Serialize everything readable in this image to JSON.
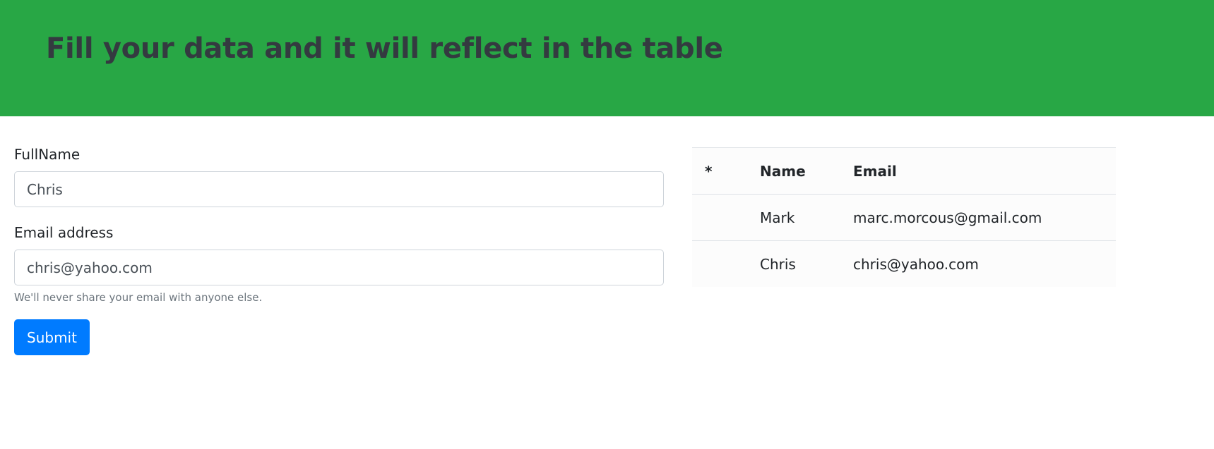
{
  "header": {
    "title": "Fill your data and it will reflect in the table"
  },
  "form": {
    "fullname_label": "FullName",
    "fullname_value": "Chris",
    "email_label": "Email address",
    "email_value": "chris@yahoo.com",
    "email_help": "We'll never share your email with anyone else.",
    "submit_label": "Submit"
  },
  "table": {
    "headers": [
      "*",
      "Name",
      "Email"
    ],
    "rows": [
      {
        "index": "",
        "name": "Mark",
        "email": "marc.morcous@gmail.com"
      },
      {
        "index": "",
        "name": "Chris",
        "email": "chris@yahoo.com"
      }
    ]
  },
  "colors": {
    "header_bg": "#28a745",
    "title_text": "#343a40",
    "button_bg": "#007bff",
    "help_text": "#6c757d"
  }
}
